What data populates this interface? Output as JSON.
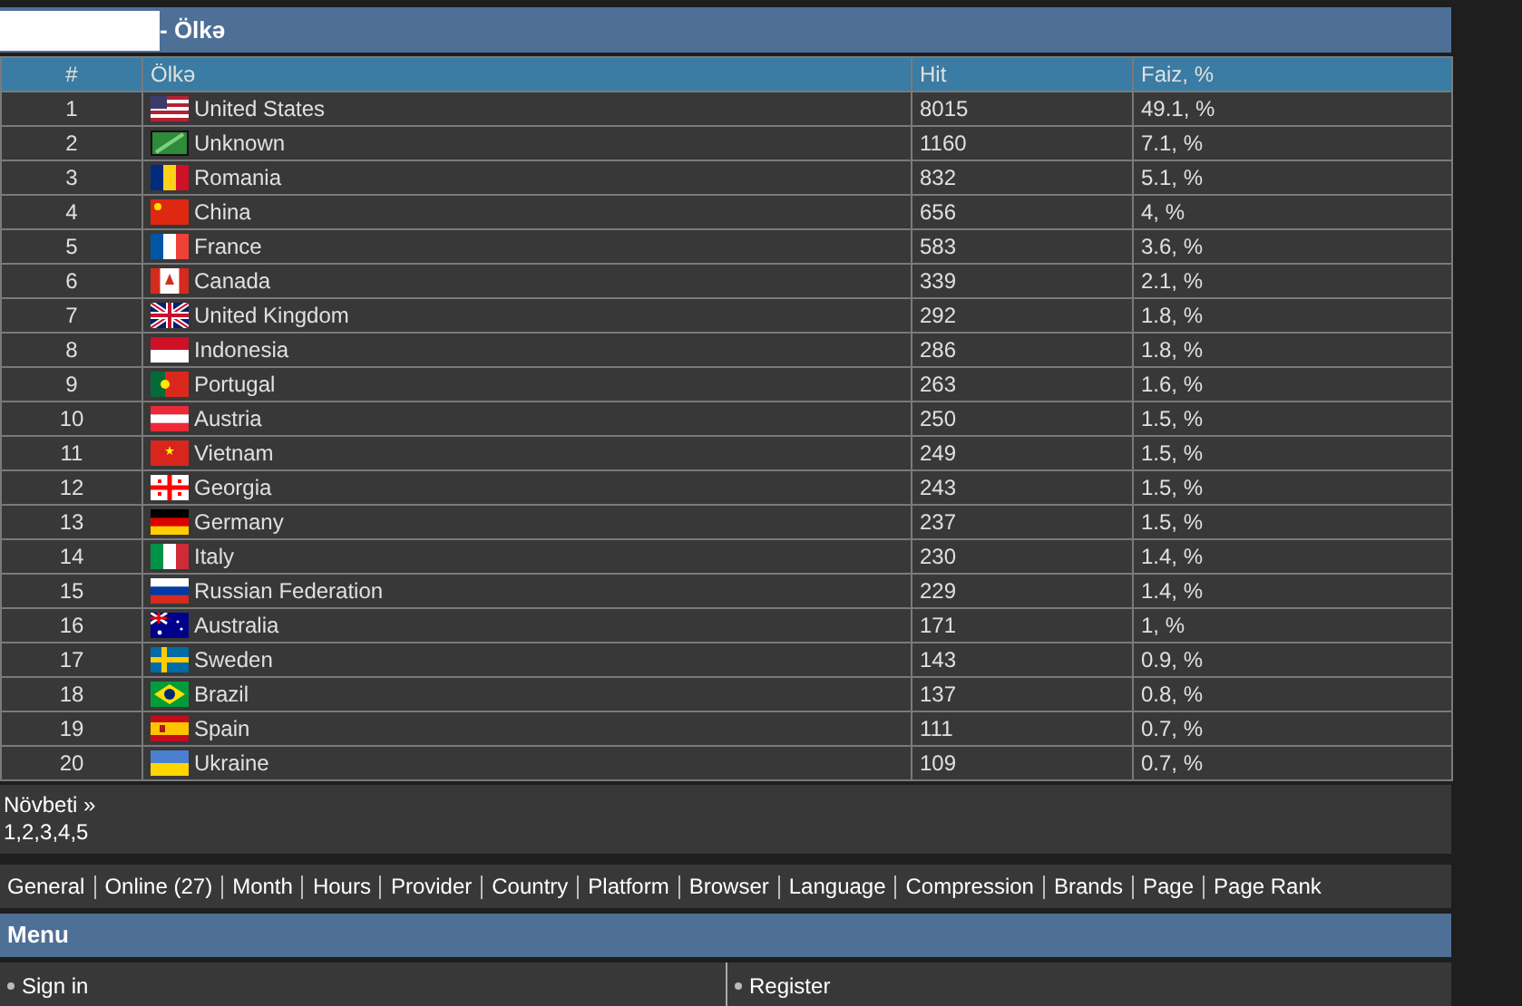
{
  "header": {
    "title": "- Ölkə"
  },
  "table": {
    "columns": [
      "#",
      "Ölkə",
      "Hit",
      "Faiz, %"
    ],
    "rows": [
      {
        "rank": "1",
        "kind": "us",
        "country": "United States",
        "hit": "8015",
        "percent": "49.1, %"
      },
      {
        "rank": "2",
        "kind": "unknown",
        "country": "Unknown",
        "hit": "1160",
        "percent": "7.1, %"
      },
      {
        "rank": "3",
        "kind": "ro",
        "country": "Romania",
        "hit": "832",
        "percent": "5.1, %"
      },
      {
        "rank": "4",
        "kind": "cn",
        "country": "China",
        "hit": "656",
        "percent": "4, %"
      },
      {
        "rank": "5",
        "kind": "fr",
        "country": "France",
        "hit": "583",
        "percent": "3.6, %"
      },
      {
        "rank": "6",
        "kind": "ca",
        "country": "Canada",
        "hit": "339",
        "percent": "2.1, %"
      },
      {
        "rank": "7",
        "kind": "gb",
        "country": "United Kingdom",
        "hit": "292",
        "percent": "1.8, %"
      },
      {
        "rank": "8",
        "kind": "id",
        "country": "Indonesia",
        "hit": "286",
        "percent": "1.8, %"
      },
      {
        "rank": "9",
        "kind": "pt",
        "country": "Portugal",
        "hit": "263",
        "percent": "1.6, %"
      },
      {
        "rank": "10",
        "kind": "at",
        "country": "Austria",
        "hit": "250",
        "percent": "1.5, %"
      },
      {
        "rank": "11",
        "kind": "vn",
        "country": "Vietnam",
        "hit": "249",
        "percent": "1.5, %"
      },
      {
        "rank": "12",
        "kind": "ge",
        "country": "Georgia",
        "hit": "243",
        "percent": "1.5, %"
      },
      {
        "rank": "13",
        "kind": "de",
        "country": "Germany",
        "hit": "237",
        "percent": "1.5, %"
      },
      {
        "rank": "14",
        "kind": "it",
        "country": "Italy",
        "hit": "230",
        "percent": "1.4, %"
      },
      {
        "rank": "15",
        "kind": "ru",
        "country": "Russian Federation",
        "hit": "229",
        "percent": "1.4, %"
      },
      {
        "rank": "16",
        "kind": "au",
        "country": "Australia",
        "hit": "171",
        "percent": "1, %"
      },
      {
        "rank": "17",
        "kind": "se",
        "country": "Sweden",
        "hit": "143",
        "percent": "0.9, %"
      },
      {
        "rank": "18",
        "kind": "br",
        "country": "Brazil",
        "hit": "137",
        "percent": "0.8, %"
      },
      {
        "rank": "19",
        "kind": "es",
        "country": "Spain",
        "hit": "111",
        "percent": "0.7, %"
      },
      {
        "rank": "20",
        "kind": "ua",
        "country": "Ukraine",
        "hit": "109",
        "percent": "0.7, %"
      }
    ]
  },
  "pagination": {
    "next": "Növbeti »",
    "pages": "1,2,3,4,5"
  },
  "nav_links": [
    "General",
    "Online (27)",
    "Month",
    "Hours",
    "Provider",
    "Country",
    "Platform",
    "Browser",
    "Language",
    "Compression",
    "Brands",
    "Page",
    "Page Rank"
  ],
  "menu": {
    "title": "Menu",
    "items": [
      "Sign in",
      "Register"
    ]
  }
}
